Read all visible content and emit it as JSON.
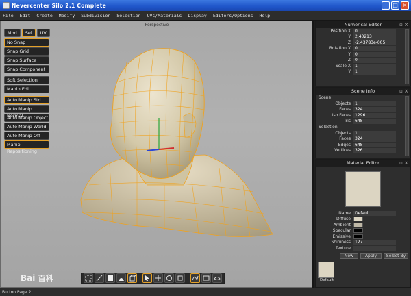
{
  "window": {
    "title": "Nevercenter Silo 2.1 Complete",
    "min": "_",
    "max": "□",
    "close": "×"
  },
  "menu": [
    "File",
    "Edit",
    "Create",
    "Modify",
    "Subdivision",
    "Selection",
    "UVs/Materials",
    "Display",
    "Editors/Options",
    "Help"
  ],
  "viewport": {
    "label": "Perspective"
  },
  "toolbar_left": {
    "modes": [
      "Mod",
      "Sel",
      "UV"
    ],
    "active_mode": "Sel",
    "snap": [
      "No Snap",
      "Snap Grid",
      "Snap Surface",
      "Snap Component"
    ],
    "edit": [
      "Soft Selection",
      "Manip Edit"
    ],
    "manip": [
      "Auto Manip Std",
      "Auto Manip Normal",
      "Auto Manip Object",
      "Auto Manip World",
      "Auto Manip Off",
      "Manip Repositioning"
    ]
  },
  "numerical_editor": {
    "title": "Numerical Editor",
    "position": {
      "label": "Position",
      "x": "0",
      "y": "2.40213",
      "z": "-2.43783e-005"
    },
    "rotation": {
      "label": "Rotation",
      "x": "0",
      "y": "0",
      "z": "0"
    },
    "scale": {
      "label": "Scale",
      "x": "1",
      "y": "1"
    }
  },
  "scene_info": {
    "title": "Scene Info",
    "scene_label": "Scene",
    "objects": "1",
    "faces": "324",
    "iso_faces": "1296",
    "tris": "648",
    "selection_label": "Selection",
    "sel_objects": "1",
    "sel_faces": "324",
    "sel_edges": "648",
    "sel_vertices": "326"
  },
  "material_editor": {
    "title": "Material Editor",
    "name_label": "Name",
    "name_value": "Default",
    "diffuse": "Diffuse",
    "ambient": "Ambient",
    "specular": "Specular",
    "emissive": "Emissive",
    "shininess_label": "Shininess",
    "shininess_value": "127",
    "texture_label": "Texture",
    "new_btn": "New",
    "apply_btn": "Apply",
    "selectby_btn": "Select By",
    "default_label": "Default",
    "colors": {
      "diffuse": "#dcd5c2",
      "ambient": "#bfb8a6",
      "specular": "#000000",
      "emissive": "#000000"
    }
  },
  "watermark": {
    "text": "Bai",
    "zh": "百科"
  },
  "status": {
    "text": "Button Page 2"
  },
  "colors": {
    "accent": "#e4a12a",
    "mesh": "#d9cfae",
    "wire": "#f0a21e"
  }
}
